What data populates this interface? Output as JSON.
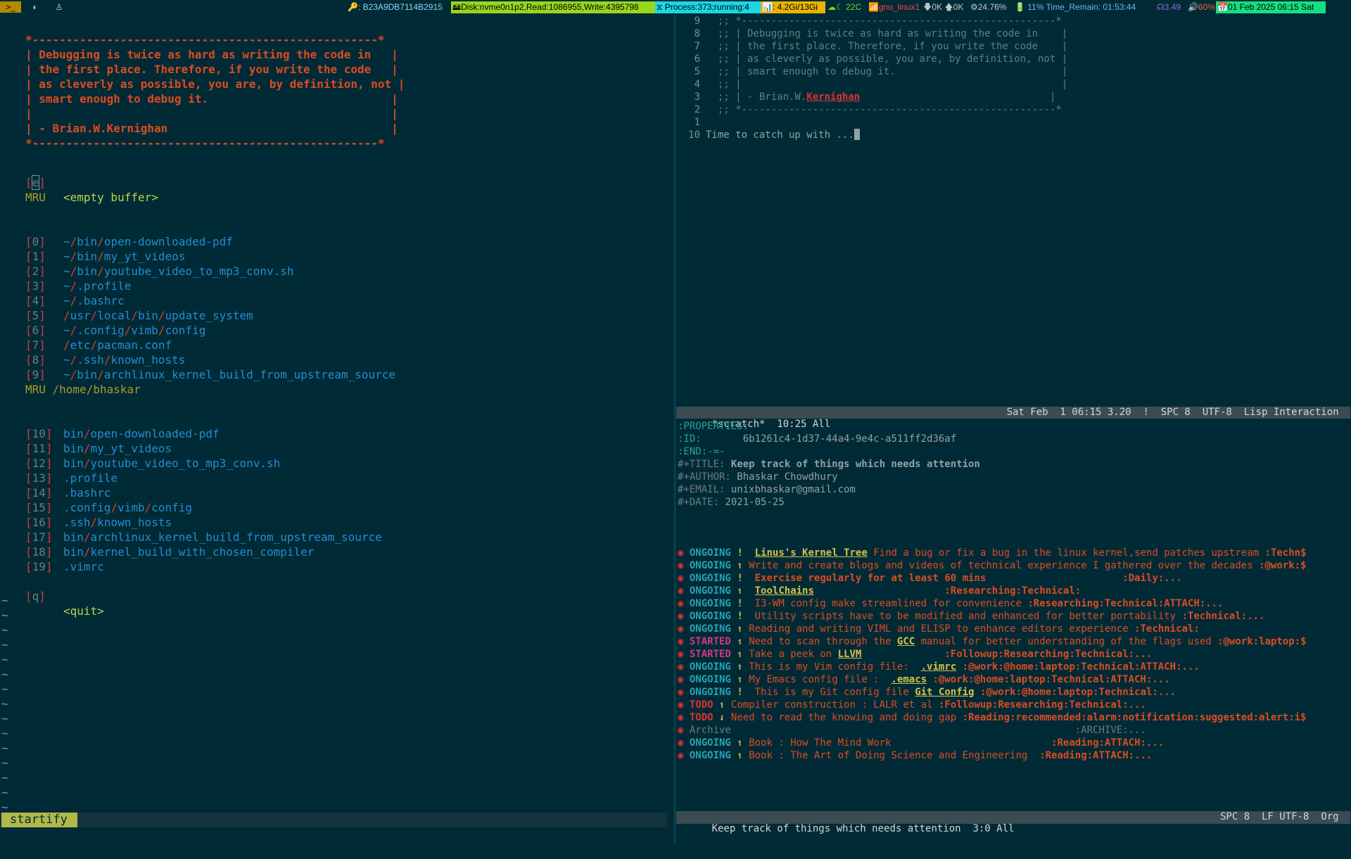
{
  "topbar": {
    "workspaces": [
      ">_",
      "◐",
      "♙"
    ],
    "segments": [
      {
        "text": "🔑: B23A9DB7114B2915",
        "bg": "#002b36",
        "fg": "#89d4f5"
      },
      {
        "text": "🖴Disk:nvme0n1p2,Read:1086955,Write:4395798",
        "bg": "#9ad61b",
        "fg": "#000000"
      },
      {
        "text": "⧖ Process:373;running:4",
        "bg": "#1ad7e6",
        "fg": "#000000"
      },
      {
        "text": "📊: 4.2Gi/13Gi",
        "bg": "#e8b400",
        "fg": "#000000"
      },
      {
        "text": "☁☾ 22C",
        "bg": "#002b36",
        "fg": "#7ed321"
      },
      {
        "text": "📶gnu_linux1",
        "bg": "#002b36",
        "fg": "#ff4040"
      },
      {
        "text": "🡇0K 🡅0K",
        "bg": "#002b36",
        "fg": "#c0c8cc"
      },
      {
        "text": "⚙24.76%",
        "bg": "#002b36",
        "fg": "#c0c8cc"
      },
      {
        "text": "🔋 11% Time_Remain: 01:53:44",
        "bg": "#002b36",
        "fg": "#6eb5f0"
      },
      {
        "text": "☊3.49",
        "bg": "#002b36",
        "fg": "#8a6cd9"
      },
      {
        "text": "🔊60%",
        "bg": "#002b36",
        "fg": "#ff5a3c"
      },
      {
        "text": "📅01 Feb 2025 06:15 Sat",
        "bg": "#13e081",
        "fg": "#000000"
      }
    ]
  },
  "startify": {
    "quote_lines": [
      "*---------------------------------------------------*",
      "| Debugging is twice as hard as writing the code in   |",
      "| the first place. Therefore, if you write the code   |",
      "| as cleverly as possible, you are, by definition, not |",
      "| smart enough to debug it.                           |",
      "|                                                     |",
      "| - Brian.W.Kernighan                                 |",
      "*---------------------------------------------------*"
    ],
    "empty_key": "e",
    "empty_label": "<empty buffer>",
    "mru_header": "MRU",
    "mru_items": [
      {
        "key": "0",
        "path": "~/bin/open-downloaded-pdf"
      },
      {
        "key": "1",
        "path": "~/bin/my_yt_videos"
      },
      {
        "key": "2",
        "path": "~/bin/youtube_video_to_mp3_conv.sh"
      },
      {
        "key": "3",
        "path": "~/.profile"
      },
      {
        "key": "4",
        "path": "~/.bashrc"
      },
      {
        "key": "5",
        "path": "/usr/local/bin/update_system"
      },
      {
        "key": "6",
        "path": "~/.config/vimb/config"
      },
      {
        "key": "7",
        "path": "/etc/pacman.conf"
      },
      {
        "key": "8",
        "path": "~/.ssh/known_hosts"
      },
      {
        "key": "9",
        "path": "~/bin/archlinux_kernel_build_from_upstream_source"
      }
    ],
    "mru_dir_header": "MRU /home/bhaskar",
    "mru_dir_items": [
      {
        "key": "10",
        "path": "bin/open-downloaded-pdf"
      },
      {
        "key": "11",
        "path": "bin/my_yt_videos"
      },
      {
        "key": "12",
        "path": "bin/youtube_video_to_mp3_conv.sh"
      },
      {
        "key": "13",
        "path": ".profile"
      },
      {
        "key": "14",
        "path": ".bashrc"
      },
      {
        "key": "15",
        "path": ".config/vimb/config"
      },
      {
        "key": "16",
        "path": ".ssh/known_hosts"
      },
      {
        "key": "17",
        "path": "bin/archlinux_kernel_build_from_upstream_source"
      },
      {
        "key": "18",
        "path": "bin/kernel_build_with_chosen_compiler"
      },
      {
        "key": "19",
        "path": ".vimrc"
      }
    ],
    "quit_key": "q",
    "quit_label": "<quit>",
    "tilde": "~",
    "mode_label": "startify"
  },
  "scratch": {
    "lines": [
      {
        "num": "9",
        "text": "  ;; *-----------------------------------------------------*"
      },
      {
        "num": "8",
        "text": "  ;; | Debugging is twice as hard as writing the code in    |"
      },
      {
        "num": "7",
        "text": "  ;; | the first place. Therefore, if you write the code    |"
      },
      {
        "num": "6",
        "text": "  ;; | as cleverly as possible, you are, by definition, not |"
      },
      {
        "num": "5",
        "text": "  ;; | smart enough to debug it.                            |"
      },
      {
        "num": "4",
        "text": "  ;; |                                                      |"
      },
      {
        "num": "3",
        "text": "  ;; | - Brian.W.",
        "link": "Kernighan",
        "after": "                                |"
      },
      {
        "num": "2",
        "text": "  ;; *-----------------------------------------------------*"
      },
      {
        "num": "1",
        "text": ""
      },
      {
        "num": "10",
        "text": "Time to catch up with ..."
      }
    ],
    "modeline_left": "  *scratch*  10:25 All",
    "modeline_right": "Sat Feb  1 06:15 3.20  !  SPC 8  UTF-8  Lisp Interaction "
  },
  "org": {
    "props": [
      {
        "k": ":PROPERTIES:",
        "v": ""
      },
      {
        "k": ":ID:       ",
        "v": "6b1261c4-1d37-44a4-9e4c-a511ff2d36af"
      },
      {
        "k": ":END:-=-",
        "v": ""
      },
      {
        "k": "#+TITLE: ",
        "v": "Keep track of things which needs attention",
        "bold": true
      },
      {
        "k": "#+AUTHOR: ",
        "v": "Bhaskar Chowdhury"
      },
      {
        "k": "#+EMAIL: ",
        "v": "unixbhaskar@gmail.com"
      },
      {
        "k": "#+DATE: ",
        "v": "2021-05-25"
      }
    ],
    "items": [
      {
        "kw": "ONGOING",
        "pri": "!",
        "pre": " ",
        "link": "Linus's Kernel Tree",
        "text": " Find a bug or fix a bug in the linux kernel,send patches upstream ",
        "tags": ":Techn$"
      },
      {
        "kw": "ONGOING",
        "pri": "↿",
        "pre": "",
        "link": "",
        "text": "Write and create blogs and videos of technical experience I gathered over the decades ",
        "tags": ":@work:$"
      },
      {
        "kw": "ONGOING",
        "pri": "!",
        "pre": " ",
        "link": "",
        "text": "Exercise regularly for at least 60 mins",
        "textbold": true,
        "tags": "                       :Daily:..."
      },
      {
        "kw": "ONGOING",
        "pri": "↿",
        "pre": " ",
        "link": "ToolChains",
        "text": "                      ",
        "tags": ":Researching:Technical:"
      },
      {
        "kw": "ONGOING",
        "pri": "!",
        "pre": " ",
        "link": "",
        "text": "I3-WM config make streamlined for convenience ",
        "tags": ":Researching:Technical:ATTACH:..."
      },
      {
        "kw": "ONGOING",
        "pri": "!",
        "pre": " ",
        "link": "",
        "text": "Utility scripts have to be modified and enhanced for better portability ",
        "tags": ":Technical:..."
      },
      {
        "kw": "ONGOING",
        "pri": "↿",
        "pre": "",
        "link": "",
        "text": "Reading and writing VIML and ELISP to enhance editors experience ",
        "tags": ":Technical:"
      },
      {
        "kw": "STARTED",
        "pri": "↿",
        "pre": "",
        "link": "",
        "text": "Need to scan through the ",
        "link2": "GCC",
        "text2": " manual for better understanding of the flags used ",
        "tags": ":@work:laptop:$"
      },
      {
        "kw": "STARTED",
        "pri": "↿",
        "pre": "",
        "link": "",
        "text": "Take a peek on ",
        "link2": "LLVM",
        "text2": "              ",
        "tags": ":Followup:Researching:Technical:..."
      },
      {
        "kw": "ONGOING",
        "pri": "↿",
        "pre": "",
        "link": "",
        "text": "This is my Vim config file:  ",
        "link2": ".vimrc",
        "text2": " ",
        "tags": ":@work:@home:laptop:Technical:ATTACH:..."
      },
      {
        "kw": "ONGOING",
        "pri": "↿",
        "pre": "",
        "link": "",
        "text": "My Emacs config file :  ",
        "link2": ".emacs",
        "text2": " ",
        "tags": ":@work:@home:laptop:Technical:ATTACH:..."
      },
      {
        "kw": "ONGOING",
        "pri": "!",
        "pre": " ",
        "link": "",
        "text": "This is my Git config file ",
        "link2": "Git Config",
        "text2": " ",
        "tags": ":@work:@home:laptop:Technical:..."
      },
      {
        "kw": "TODO",
        "pri": "↿",
        "pre": "",
        "link": "",
        "text": "Compiler construction : LALR et al ",
        "tags": ":Followup:Researching:Technical:..."
      },
      {
        "kw": "TODO",
        "pri": "⇃",
        "pre": "",
        "link": "",
        "text": "Need to read the knowing and doing gap ",
        "tags": ":Reading:recommended:alarm:notification:suggested:alert:i$"
      },
      {
        "kw": "",
        "archive": "Archive",
        "tags": "                                                          :ARCHIVE:..."
      },
      {
        "kw": "ONGOING",
        "pri": "↿",
        "pre": "",
        "link": "",
        "text": "Book : How The Mind Work                           ",
        "tags": ":Reading:ATTACH:..."
      },
      {
        "kw": "ONGOING",
        "pri": "↿",
        "pre": "",
        "link": "",
        "text": "Book : The Art of Doing Science and Engineering  ",
        "tags": ":Reading:ATTACH:..."
      }
    ],
    "modeline_left": "  Keep track of things which needs attention  3:0 All",
    "modeline_right": "SPC 8  LF UTF-8  Org "
  }
}
